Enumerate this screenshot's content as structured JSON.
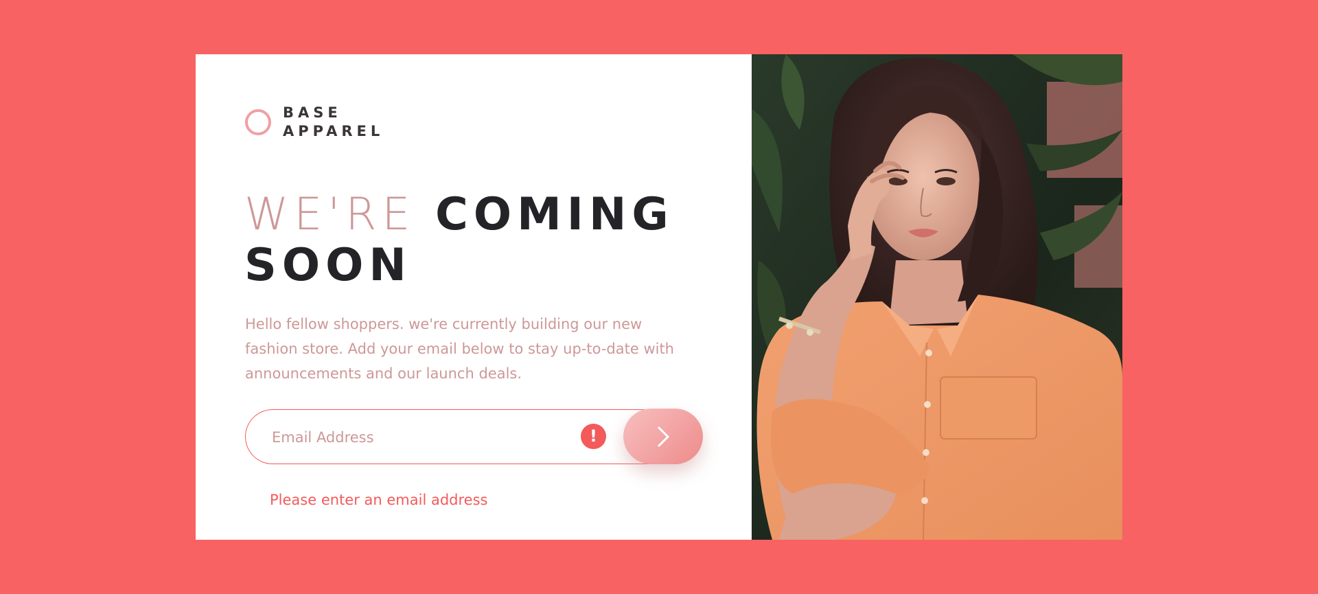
{
  "brand": {
    "line1": "BASE",
    "line2": "APPAREL"
  },
  "headline": {
    "light": "WE'RE",
    "strong_1": "COMING",
    "strong_2": "SOON"
  },
  "description": "Hello fellow shoppers. we're currently building our new fashion store. Add your email below to stay up-to-date with announcements and our launch deals.",
  "form": {
    "email_placeholder": "Email Address",
    "email_value": "",
    "error_icon": "!",
    "submit_icon": "chevron-right-icon",
    "error_message": "Please enter an email address"
  },
  "colors": {
    "background": "#f86262",
    "accent": "#ce9797",
    "error": "#f35a5a",
    "dark_text": "#242428"
  },
  "hero_image": {
    "icon": "model-photo"
  }
}
